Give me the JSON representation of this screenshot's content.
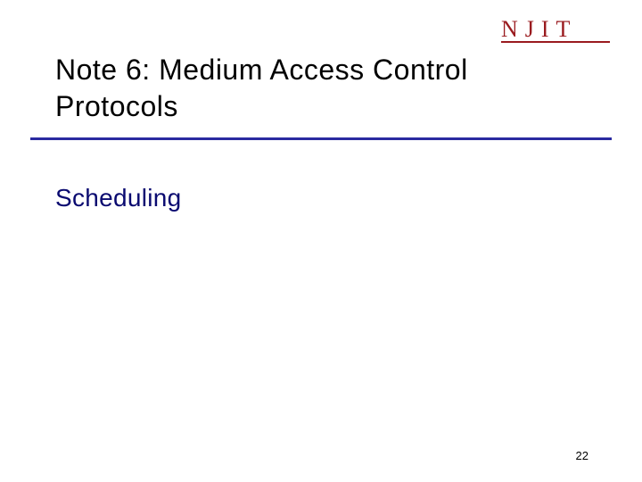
{
  "logo": {
    "text": "NJIT"
  },
  "title": "Note 6: Medium Access Control Protocols",
  "subtitle": "Scheduling",
  "page_number": "22",
  "colors": {
    "logo": "#9a1b1f",
    "rule": "#2a2aa0",
    "subtitle": "#0a0a70"
  }
}
